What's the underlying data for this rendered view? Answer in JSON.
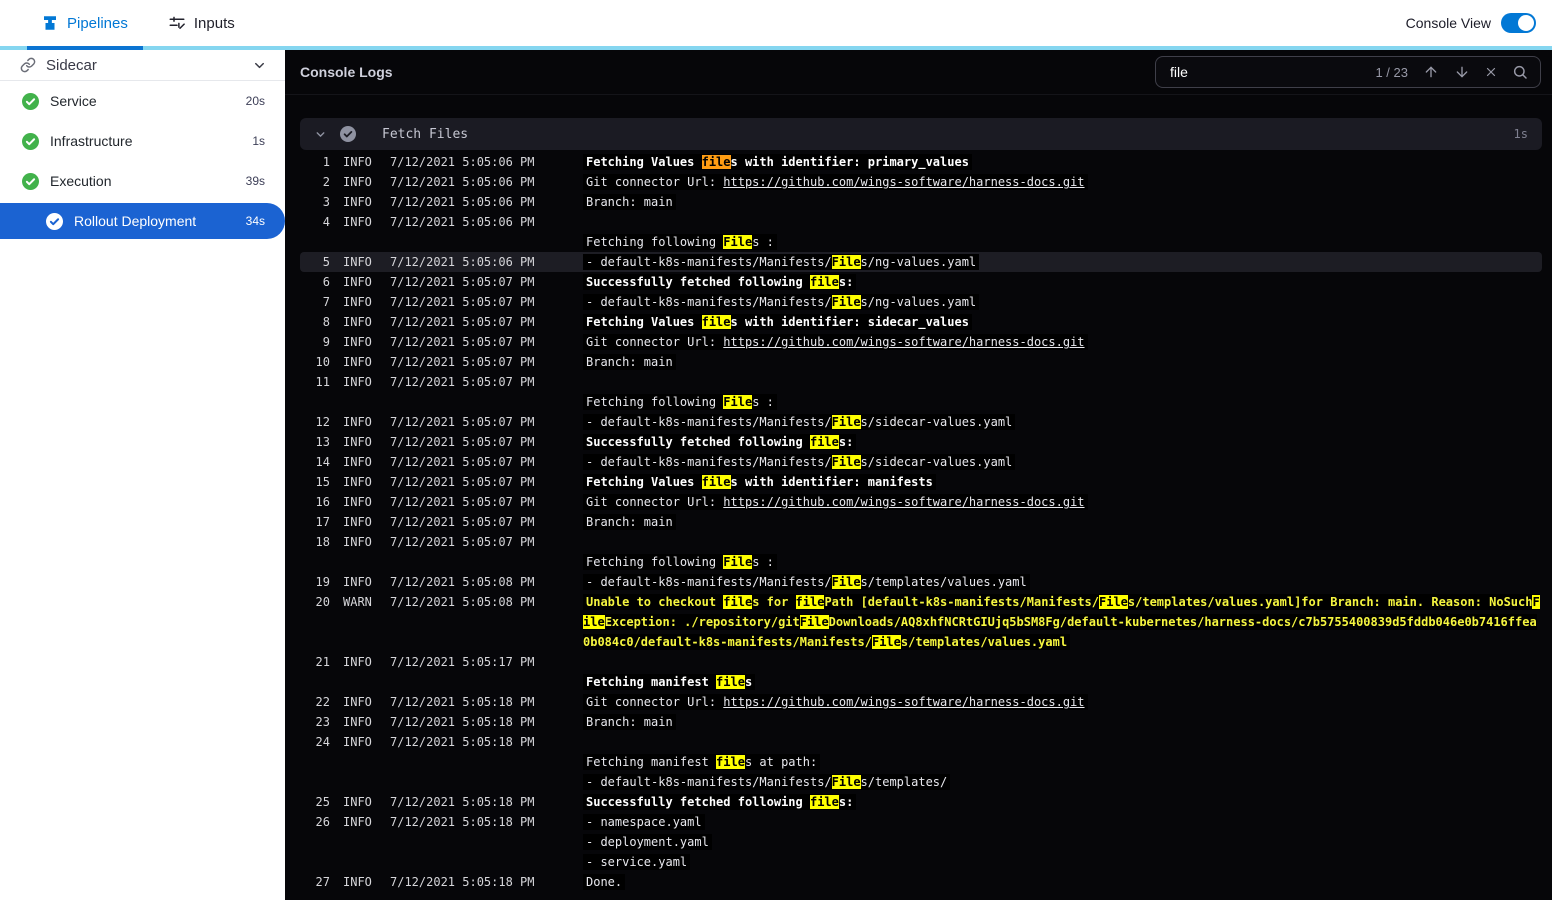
{
  "topbar": {
    "tabs": [
      {
        "label": "Pipelines",
        "active": true
      },
      {
        "label": "Inputs",
        "active": false
      }
    ],
    "console_view_label": "Console View",
    "console_view_on": true
  },
  "sidebar": {
    "header": {
      "label": "Sidecar"
    },
    "items": [
      {
        "label": "Service",
        "duration": "20s",
        "status": "success",
        "selected": false
      },
      {
        "label": "Infrastructure",
        "duration": "1s",
        "status": "success",
        "selected": false
      },
      {
        "label": "Execution",
        "duration": "39s",
        "status": "success",
        "selected": false
      },
      {
        "label": "Rollout Deployment",
        "duration": "34s",
        "status": "success",
        "selected": true
      }
    ]
  },
  "console": {
    "title": "Console Logs",
    "search": {
      "value": "file",
      "counter": "1 / 23"
    },
    "section": {
      "title": "Fetch Files",
      "duration": "1s"
    },
    "colors": {
      "accent_blue": "#0278d5",
      "selected_blue": "#1b63d2",
      "success_green": "#42b24b",
      "match_yellow": "#ffff00",
      "current_match_orange": "#ff9d13",
      "warn_text": "#f5f53f",
      "tabstrip_light_blue": "#85d6f0"
    },
    "icons": [
      "pipeline-icon",
      "inputs-icon",
      "link-icon",
      "chevron-down-icon",
      "check-circle-icon",
      "search-icon",
      "arrow-up-icon",
      "arrow-down-icon",
      "close-icon",
      "toggle-switch"
    ],
    "logs": [
      {
        "n": 1,
        "lvl": "INFO",
        "t": "7/12/2021 5:05:06 PM",
        "lines": [
          [
            [
              "Fetching Values ",
              "b"
            ],
            [
              "file",
              "o"
            ],
            [
              "s with identifier: primary_values",
              "b"
            ]
          ]
        ]
      },
      {
        "n": 2,
        "lvl": "INFO",
        "t": "7/12/2021 5:05:06 PM",
        "lines": [
          [
            [
              "Git connector Url: ",
              ""
            ],
            [
              "https://github.com/wings-software/harness-docs.git",
              "u"
            ]
          ]
        ]
      },
      {
        "n": 3,
        "lvl": "INFO",
        "t": "7/12/2021 5:05:06 PM",
        "lines": [
          [
            [
              "Branch: main",
              ""
            ]
          ]
        ]
      },
      {
        "n": 4,
        "lvl": "INFO",
        "t": "7/12/2021 5:05:06 PM",
        "lines": [
          [],
          [
            [
              "Fetching following ",
              ""
            ],
            [
              "File",
              "y"
            ],
            [
              "s :",
              ""
            ]
          ]
        ]
      },
      {
        "n": 5,
        "lvl": "INFO",
        "t": "7/12/2021 5:05:06 PM",
        "hl": true,
        "lines": [
          [
            [
              "- default-k8s-manifests/Manifests/",
              ""
            ],
            [
              "File",
              "y"
            ],
            [
              "s/ng-values.yaml",
              ""
            ]
          ]
        ]
      },
      {
        "n": 6,
        "lvl": "INFO",
        "t": "7/12/2021 5:05:07 PM",
        "lines": [
          [
            [
              "Successfully fetched following ",
              "b"
            ],
            [
              "file",
              "yb"
            ],
            [
              "s:",
              "b"
            ]
          ]
        ]
      },
      {
        "n": 7,
        "lvl": "INFO",
        "t": "7/12/2021 5:05:07 PM",
        "lines": [
          [
            [
              "- default-k8s-manifests/Manifests/",
              ""
            ],
            [
              "File",
              "y"
            ],
            [
              "s/ng-values.yaml",
              ""
            ]
          ]
        ]
      },
      {
        "n": 8,
        "lvl": "INFO",
        "t": "7/12/2021 5:05:07 PM",
        "lines": [
          [
            [
              "Fetching Values ",
              "b"
            ],
            [
              "file",
              "yb"
            ],
            [
              "s with identifier: sidecar_values",
              "b"
            ]
          ]
        ]
      },
      {
        "n": 9,
        "lvl": "INFO",
        "t": "7/12/2021 5:05:07 PM",
        "lines": [
          [
            [
              "Git connector Url: ",
              ""
            ],
            [
              "https://github.com/wings-software/harness-docs.git",
              "u"
            ]
          ]
        ]
      },
      {
        "n": 10,
        "lvl": "INFO",
        "t": "7/12/2021 5:05:07 PM",
        "lines": [
          [
            [
              "Branch: main",
              ""
            ]
          ]
        ]
      },
      {
        "n": 11,
        "lvl": "INFO",
        "t": "7/12/2021 5:05:07 PM",
        "lines": [
          [],
          [
            [
              "Fetching following ",
              ""
            ],
            [
              "File",
              "y"
            ],
            [
              "s :",
              ""
            ]
          ]
        ]
      },
      {
        "n": 12,
        "lvl": "INFO",
        "t": "7/12/2021 5:05:07 PM",
        "lines": [
          [
            [
              "- default-k8s-manifests/Manifests/",
              ""
            ],
            [
              "File",
              "y"
            ],
            [
              "s/sidecar-values.yaml",
              ""
            ]
          ]
        ]
      },
      {
        "n": 13,
        "lvl": "INFO",
        "t": "7/12/2021 5:05:07 PM",
        "lines": [
          [
            [
              "Successfully fetched following ",
              "b"
            ],
            [
              "file",
              "yb"
            ],
            [
              "s:",
              "b"
            ]
          ]
        ]
      },
      {
        "n": 14,
        "lvl": "INFO",
        "t": "7/12/2021 5:05:07 PM",
        "lines": [
          [
            [
              "- default-k8s-manifests/Manifests/",
              ""
            ],
            [
              "File",
              "y"
            ],
            [
              "s/sidecar-values.yaml",
              ""
            ]
          ]
        ]
      },
      {
        "n": 15,
        "lvl": "INFO",
        "t": "7/12/2021 5:05:07 PM",
        "lines": [
          [
            [
              "Fetching Values ",
              "b"
            ],
            [
              "file",
              "yb"
            ],
            [
              "s with identifier: manifests",
              "b"
            ]
          ]
        ]
      },
      {
        "n": 16,
        "lvl": "INFO",
        "t": "7/12/2021 5:05:07 PM",
        "lines": [
          [
            [
              "Git connector Url: ",
              ""
            ],
            [
              "https://github.com/wings-software/harness-docs.git",
              "u"
            ]
          ]
        ]
      },
      {
        "n": 17,
        "lvl": "INFO",
        "t": "7/12/2021 5:05:07 PM",
        "lines": [
          [
            [
              "Branch: main",
              ""
            ]
          ]
        ]
      },
      {
        "n": 18,
        "lvl": "INFO",
        "t": "7/12/2021 5:05:07 PM",
        "lines": [
          [],
          [
            [
              "Fetching following ",
              ""
            ],
            [
              "File",
              "y"
            ],
            [
              "s :",
              ""
            ]
          ]
        ]
      },
      {
        "n": 19,
        "lvl": "INFO",
        "t": "7/12/2021 5:05:08 PM",
        "lines": [
          [
            [
              "- default-k8s-manifests/Manifests/",
              ""
            ],
            [
              "File",
              "y"
            ],
            [
              "s/templates/values.yaml",
              ""
            ]
          ]
        ]
      },
      {
        "n": 20,
        "lvl": "WARN",
        "t": "7/12/2021 5:05:08 PM",
        "brk": true,
        "lines": [
          [
            [
              "Unable to checkout ",
              "w"
            ],
            [
              "file",
              "y"
            ],
            [
              "s for ",
              "w"
            ],
            [
              "file",
              "y"
            ],
            [
              "Path [default-k8s-manifests/Manifests/",
              "w"
            ],
            [
              "File",
              "y"
            ],
            [
              "s/templates/values.yaml]for Branch: main. Reason: NoSuch",
              "w"
            ],
            [
              "File",
              "y"
            ],
            [
              "Exception: ./repository/git",
              "w"
            ],
            [
              "File",
              "y"
            ],
            [
              "Downloads/AQ8xhfNCRtGIUjq5bSM8Fg/default-kubernetes/harness-docs/c7b5755400839d5fddb046e0b7416ffea0b084c0/default-k8s-manifests/Manifests/",
              "w"
            ],
            [
              "File",
              "y"
            ],
            [
              "s/templates/values.yaml",
              "w"
            ]
          ]
        ]
      },
      {
        "n": 21,
        "lvl": "INFO",
        "t": "7/12/2021 5:05:17 PM",
        "lines": [
          [],
          [
            [
              "Fetching manifest ",
              "b"
            ],
            [
              "file",
              "yb"
            ],
            [
              "s",
              "b"
            ]
          ]
        ]
      },
      {
        "n": 22,
        "lvl": "INFO",
        "t": "7/12/2021 5:05:18 PM",
        "lines": [
          [
            [
              "Git connector Url: ",
              ""
            ],
            [
              "https://github.com/wings-software/harness-docs.git",
              "u"
            ]
          ]
        ]
      },
      {
        "n": 23,
        "lvl": "INFO",
        "t": "7/12/2021 5:05:18 PM",
        "lines": [
          [
            [
              "Branch: main",
              ""
            ]
          ]
        ]
      },
      {
        "n": 24,
        "lvl": "INFO",
        "t": "7/12/2021 5:05:18 PM",
        "lines": [
          [],
          [
            [
              "Fetching manifest ",
              ""
            ],
            [
              "file",
              "y"
            ],
            [
              "s at path:",
              ""
            ]
          ],
          [
            [
              "- default-k8s-manifests/Manifests/",
              ""
            ],
            [
              "File",
              "y"
            ],
            [
              "s/templates/",
              ""
            ]
          ]
        ]
      },
      {
        "n": 25,
        "lvl": "INFO",
        "t": "7/12/2021 5:05:18 PM",
        "lines": [
          [
            [
              "Successfully fetched following ",
              "b"
            ],
            [
              "file",
              "yb"
            ],
            [
              "s:",
              "b"
            ]
          ]
        ]
      },
      {
        "n": 26,
        "lvl": "INFO",
        "t": "7/12/2021 5:05:18 PM",
        "lines": [
          [
            [
              "- namespace.yaml",
              ""
            ]
          ],
          [
            [
              "- deployment.yaml",
              ""
            ]
          ],
          [
            [
              "- service.yaml",
              ""
            ]
          ]
        ]
      },
      {
        "n": 27,
        "lvl": "INFO",
        "t": "7/12/2021 5:05:18 PM",
        "lines": [
          [
            [
              "Done.",
              ""
            ]
          ]
        ]
      }
    ]
  }
}
